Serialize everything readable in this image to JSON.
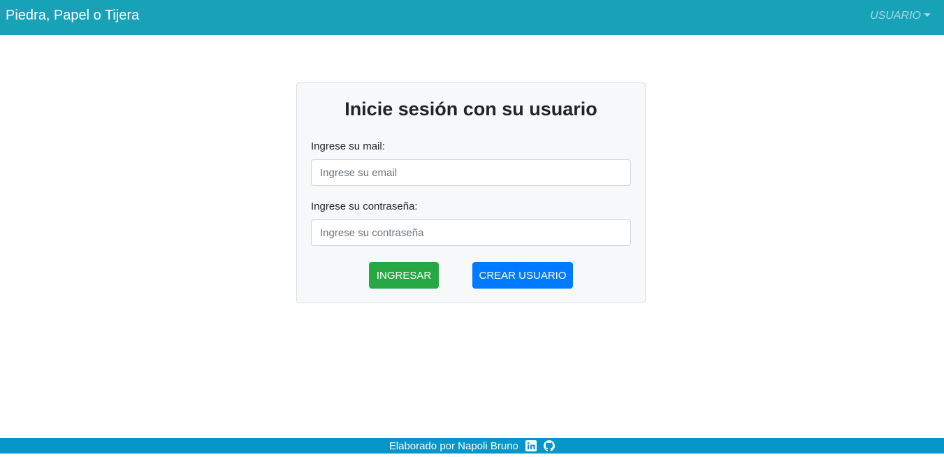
{
  "navbar": {
    "brand": "Piedra, Papel o Tijera",
    "user_menu": "USUARIO",
    "background": "#17a2b8"
  },
  "login": {
    "title": "Inicie sesión con su usuario",
    "email_label": "Ingrese su mail:",
    "email_placeholder": "Ingrese su email",
    "email_value": "",
    "password_label": "Ingrese su contraseña:",
    "password_placeholder": "Ingrese su contraseña",
    "password_value": "",
    "login_button": "INGRESAR",
    "create_button": "CREAR USUARIO",
    "login_color": "#28a745",
    "create_color": "#007bff"
  },
  "footer": {
    "text": "Elaborado por Napoli Bruno",
    "icons": [
      "linkedin-icon",
      "github-icon"
    ],
    "background": "#0796c9"
  }
}
